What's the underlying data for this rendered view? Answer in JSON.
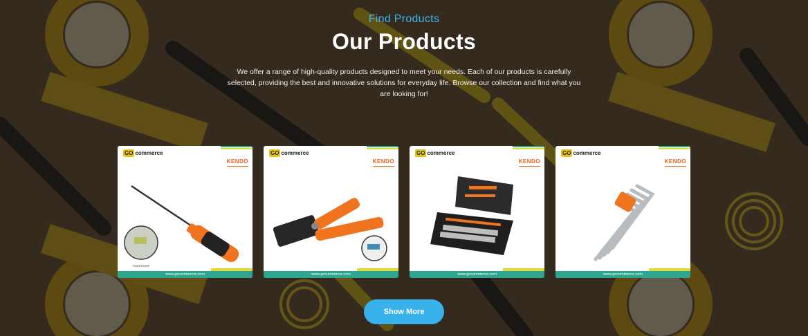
{
  "header": {
    "eyebrow": "Find Products",
    "title": "Our Products",
    "description": "We offer a range of high-quality products designed to meet your needs. Each of our products is carefully selected, providing the best and innovative solutions for everyday life. Browse our collection and find what you are looking for!"
  },
  "brand": {
    "store_logo": "commerce",
    "store_logo_badge": "GO",
    "product_brand": "KENDO",
    "website": "www.gocommerce.com"
  },
  "products": [
    {
      "image": "screwdriver",
      "footer": "www.gocommerce.com"
    },
    {
      "image": "crimping-tool",
      "footer": "www.gocommerce.com"
    },
    {
      "image": "socket-set-case",
      "footer": "www.gocommerce.com"
    },
    {
      "image": "hex-key-set",
      "footer": "www.gocommerce.com"
    }
  ],
  "actions": {
    "show_more": "Show More"
  },
  "colors": {
    "accent": "#38b2ea",
    "eyebrow": "#3fb6ee",
    "card_footer": "#2fa58f",
    "card_stripe_green": "#3aa76d",
    "card_stripe_yellow": "#d9dc3b",
    "brand_orange": "#e8641b",
    "tool_orange": "#f0741e"
  }
}
